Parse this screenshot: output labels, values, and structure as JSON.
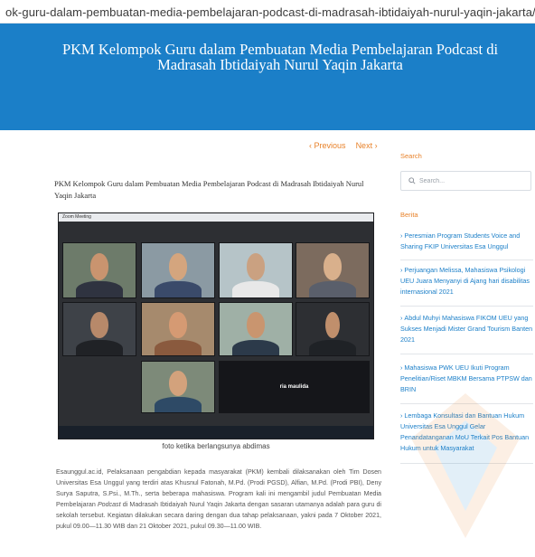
{
  "browser": {
    "url_visible": "ok-guru-dalam-pembuatan-media-pembelajaran-podcast-di-madrasah-ibtidaiyah-nurul-yaqin-jakarta/"
  },
  "hero": {
    "title": "PKM Kelompok Guru dalam Pembuatan Media Pembelajaran Podcast di Madrasah Ibtidaiyah Nurul Yaqin Jakarta",
    "background_color": "#1b7fc8"
  },
  "post_nav": {
    "previous_label": "Previous",
    "next_label": "Next",
    "accent_color": "#e8822a"
  },
  "article": {
    "title": "PKM Kelompok Guru dalam Pembuatan Media Pembelajaran Podcast di Madrasah Ibtidaiyah Nurul Yaqin Jakarta",
    "photo": {
      "window_title": "Zoom Meeting",
      "tile_name_center": "ria maulida"
    },
    "caption": "foto ketika berlangsunya abdimas",
    "paragraph_before_italic": "Esaunggul.ac.id, Pelaksanaan pengabdian kepada masyarakat (PKM) kembali dilaksanakan oleh Tim Dosen Universitas Esa Unggul yang terdiri atas Khusnul Fatonah, M.Pd. (Prodi PGSD), Alfian, M.Pd. (Prodi PBI), Deny Surya Saputra, S.Psi., M.Th., serta beberapa mahasiswa. Program kali ini mengambil judul Pembuatan Media Pembelajaran ",
    "paragraph_italic": "Podcast",
    "paragraph_after_italic": " di Madrasah Ibtidaiyah Nurul Yaqin Jakarta dengan sasaran utamanya adalah para guru di sekolah tersebut. Kegiatan dilakukan secara daring dengan dua tahap pelaksanaan, yakni pada 7 Oktober 2021, pukul 09.00—11.30 WIB dan 21 Oktober 2021, pukul 09.30—11.00 WIB."
  },
  "sidebar": {
    "search_heading": "Search",
    "search_placeholder": "Search...",
    "news_heading": "Berita",
    "news_items": [
      "Peresmian Program Students Voice and Sharing FKIP Universitas Esa Unggul",
      "Perjuangan Melissa, Mahasiswa Psikologi UEU Juara Menyanyi di Ajang hari disabilitas internasional 2021",
      "Abdul Muhyi Mahasiswa FIKOM UEU yang Sukses Menjadi Mister Grand Tourism Banten 2021",
      "Mahasiswa PWK UEU Ikuti Program Penelitian/Riset MBKM Bersama PTPSW dan BRIN",
      "Lembaga Konsultasi dan Bantuan Hukum Universitas Esa Unggul Gelar Penandatanganan MoU Terkait Pos Bantuan Hukum untuk Masyarakat"
    ]
  }
}
